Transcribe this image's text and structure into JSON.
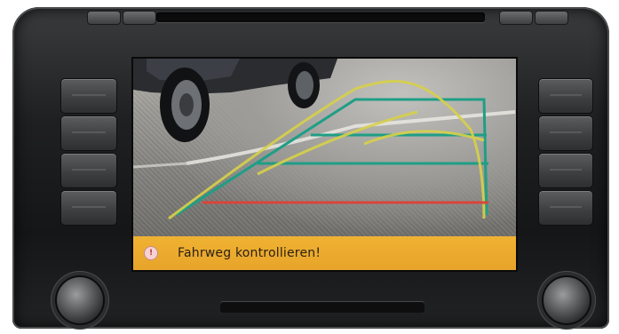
{
  "screen": {
    "status_message": "Fahrweg kontrollieren!",
    "status_icon": "warning-icon",
    "status_color": "#e9a82c"
  },
  "guide_lines": {
    "side_color": "#1f9e86",
    "path_color": "#d7d14a",
    "stop_color": "#d8453b"
  }
}
